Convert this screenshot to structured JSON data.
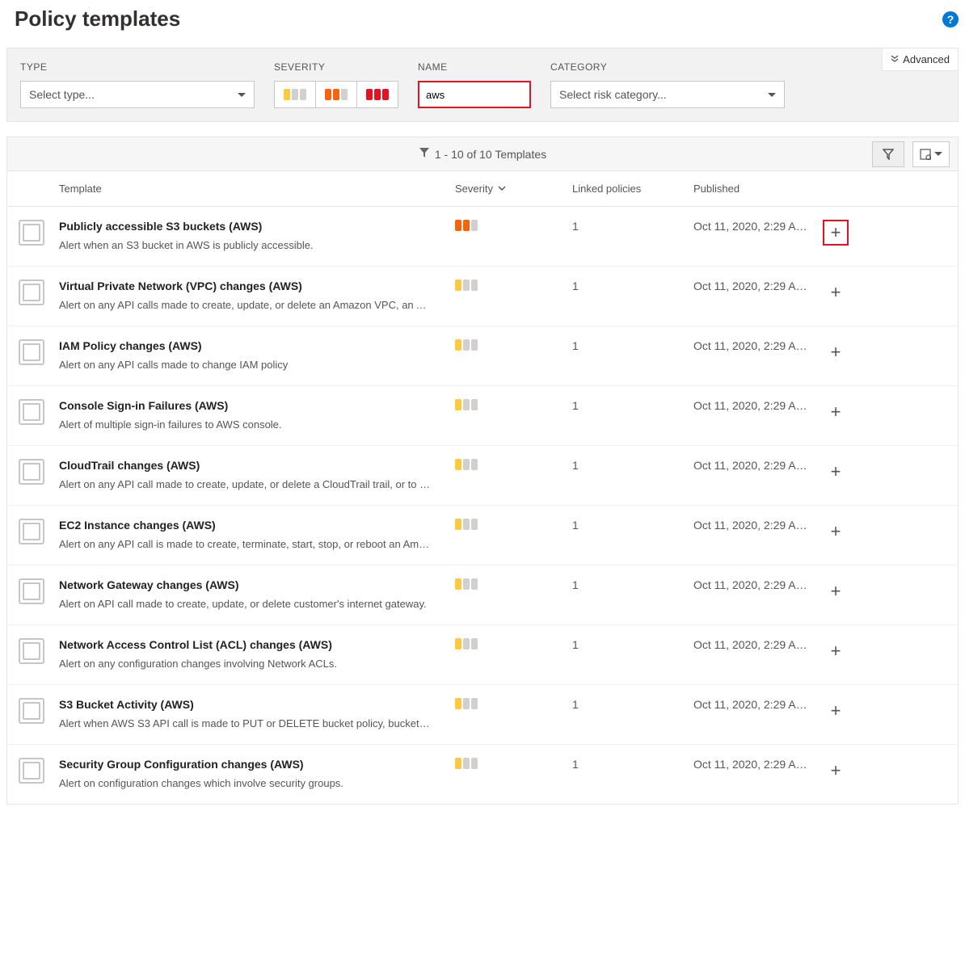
{
  "page_title": "Policy templates",
  "advanced_label": "Advanced",
  "filters": {
    "type_label": "TYPE",
    "type_placeholder": "Select type...",
    "severity_label": "SEVERITY",
    "name_label": "NAME",
    "name_value": "aws",
    "category_label": "CATEGORY",
    "category_placeholder": "Select risk category..."
  },
  "results_text": "1 - 10 of 10 Templates",
  "columns": {
    "template": "Template",
    "severity": "Severity",
    "linked": "Linked policies",
    "published": "Published"
  },
  "rows": [
    {
      "title": "Publicly accessible S3 buckets (AWS)",
      "desc": "Alert when an S3 bucket in AWS is publicly accessible.",
      "severity": "medium",
      "linked": "1",
      "published": "Oct 11, 2020, 2:29 A…",
      "highlight": true
    },
    {
      "title": "Virtual Private Network (VPC) changes (AWS)",
      "desc": "Alert on any API calls made to create, update, or delete an Amazon VPC, an A…",
      "severity": "low",
      "linked": "1",
      "published": "Oct 11, 2020, 2:29 A…"
    },
    {
      "title": "IAM Policy changes (AWS)",
      "desc": "Alert on any API calls made to change IAM policy",
      "severity": "low",
      "linked": "1",
      "published": "Oct 11, 2020, 2:29 A…"
    },
    {
      "title": "Console Sign-in Failures (AWS)",
      "desc": "Alert of multiple sign-in failures to AWS console.",
      "severity": "low",
      "linked": "1",
      "published": "Oct 11, 2020, 2:29 A…"
    },
    {
      "title": "CloudTrail changes (AWS)",
      "desc": "Alert on any API call made to create, update, or delete a CloudTrail trail, or to …",
      "severity": "low",
      "linked": "1",
      "published": "Oct 11, 2020, 2:29 A…"
    },
    {
      "title": "EC2 Instance changes (AWS)",
      "desc": "Alert on any API call is made to create, terminate, start, stop, or reboot an Am…",
      "severity": "low",
      "linked": "1",
      "published": "Oct 11, 2020, 2:29 A…"
    },
    {
      "title": "Network Gateway changes (AWS)",
      "desc": "Alert on API call made to create, update, or delete customer's internet gateway.",
      "severity": "low",
      "linked": "1",
      "published": "Oct 11, 2020, 2:29 A…"
    },
    {
      "title": "Network Access Control List (ACL) changes (AWS)",
      "desc": "Alert on any configuration changes involving Network ACLs.",
      "severity": "low",
      "linked": "1",
      "published": "Oct 11, 2020, 2:29 A…"
    },
    {
      "title": "S3 Bucket Activity (AWS)",
      "desc": "Alert when AWS S3 API call is made to PUT or DELETE bucket policy, bucket lif…",
      "severity": "low",
      "linked": "1",
      "published": "Oct 11, 2020, 2:29 A…"
    },
    {
      "title": "Security Group Configuration changes (AWS)",
      "desc": "Alert on configuration changes which involve security groups.",
      "severity": "low",
      "linked": "1",
      "published": "Oct 11, 2020, 2:29 A…"
    }
  ]
}
